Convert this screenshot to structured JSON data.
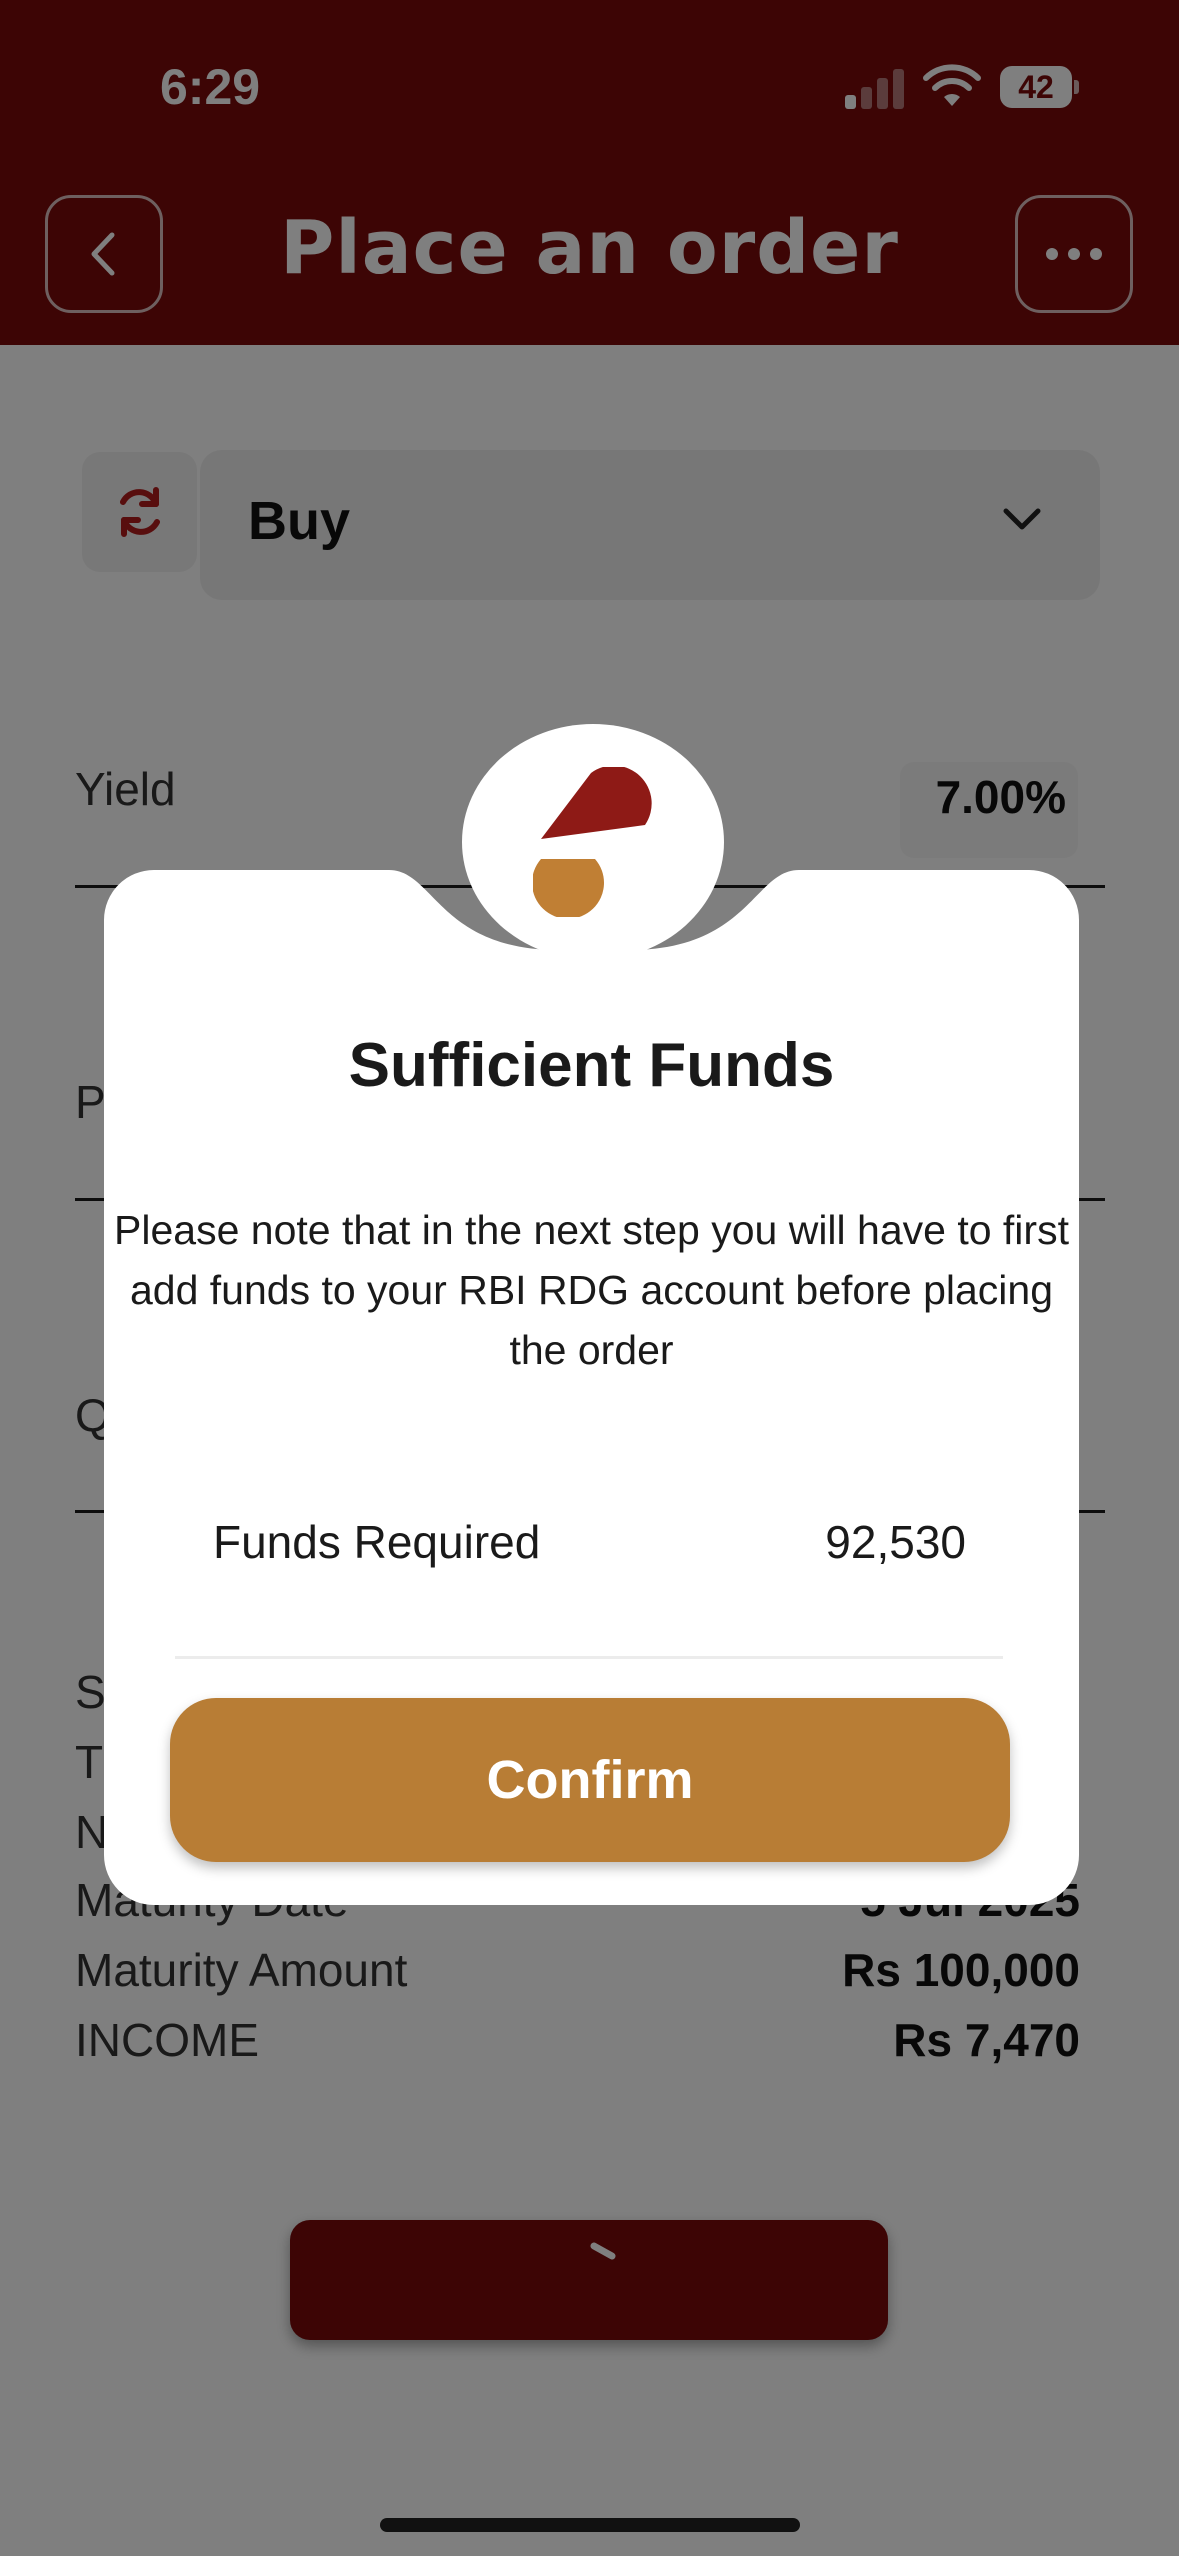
{
  "status_bar": {
    "time": "6:29",
    "battery": "42"
  },
  "header": {
    "title": "Place an order",
    "back_icon": "chevron-left-icon",
    "more_icon": "ellipsis-icon"
  },
  "order_form": {
    "side_select": {
      "value": "Buy"
    },
    "fields": {
      "yield_label": "Yield",
      "yield_value": "7.00%",
      "price_label_partial": "P",
      "quantity_label_partial": "Q"
    },
    "summary": {
      "row1_label_partial": "S",
      "row2_label_partial": "T",
      "row3_label_partial": "N",
      "maturity_date_label": "Maturity Date",
      "maturity_date_value": "5 Jul 2025",
      "maturity_amount_label": "Maturity Amount",
      "maturity_amount_value": "Rs 100,000",
      "income_label": "INCOME",
      "income_value": "Rs 7,470"
    }
  },
  "modal": {
    "title": "Sufficient Funds",
    "message": "Please note that in the next step you will have to first add funds to your RBI RDG account before placing the order",
    "funds_required_label": "Funds Required",
    "funds_required_value": "92,530",
    "confirm_label": "Confirm"
  },
  "colors": {
    "brand_maroon": "#7a0b0b",
    "accent_gold": "#b87d35",
    "logo_red": "#8e1a16"
  }
}
